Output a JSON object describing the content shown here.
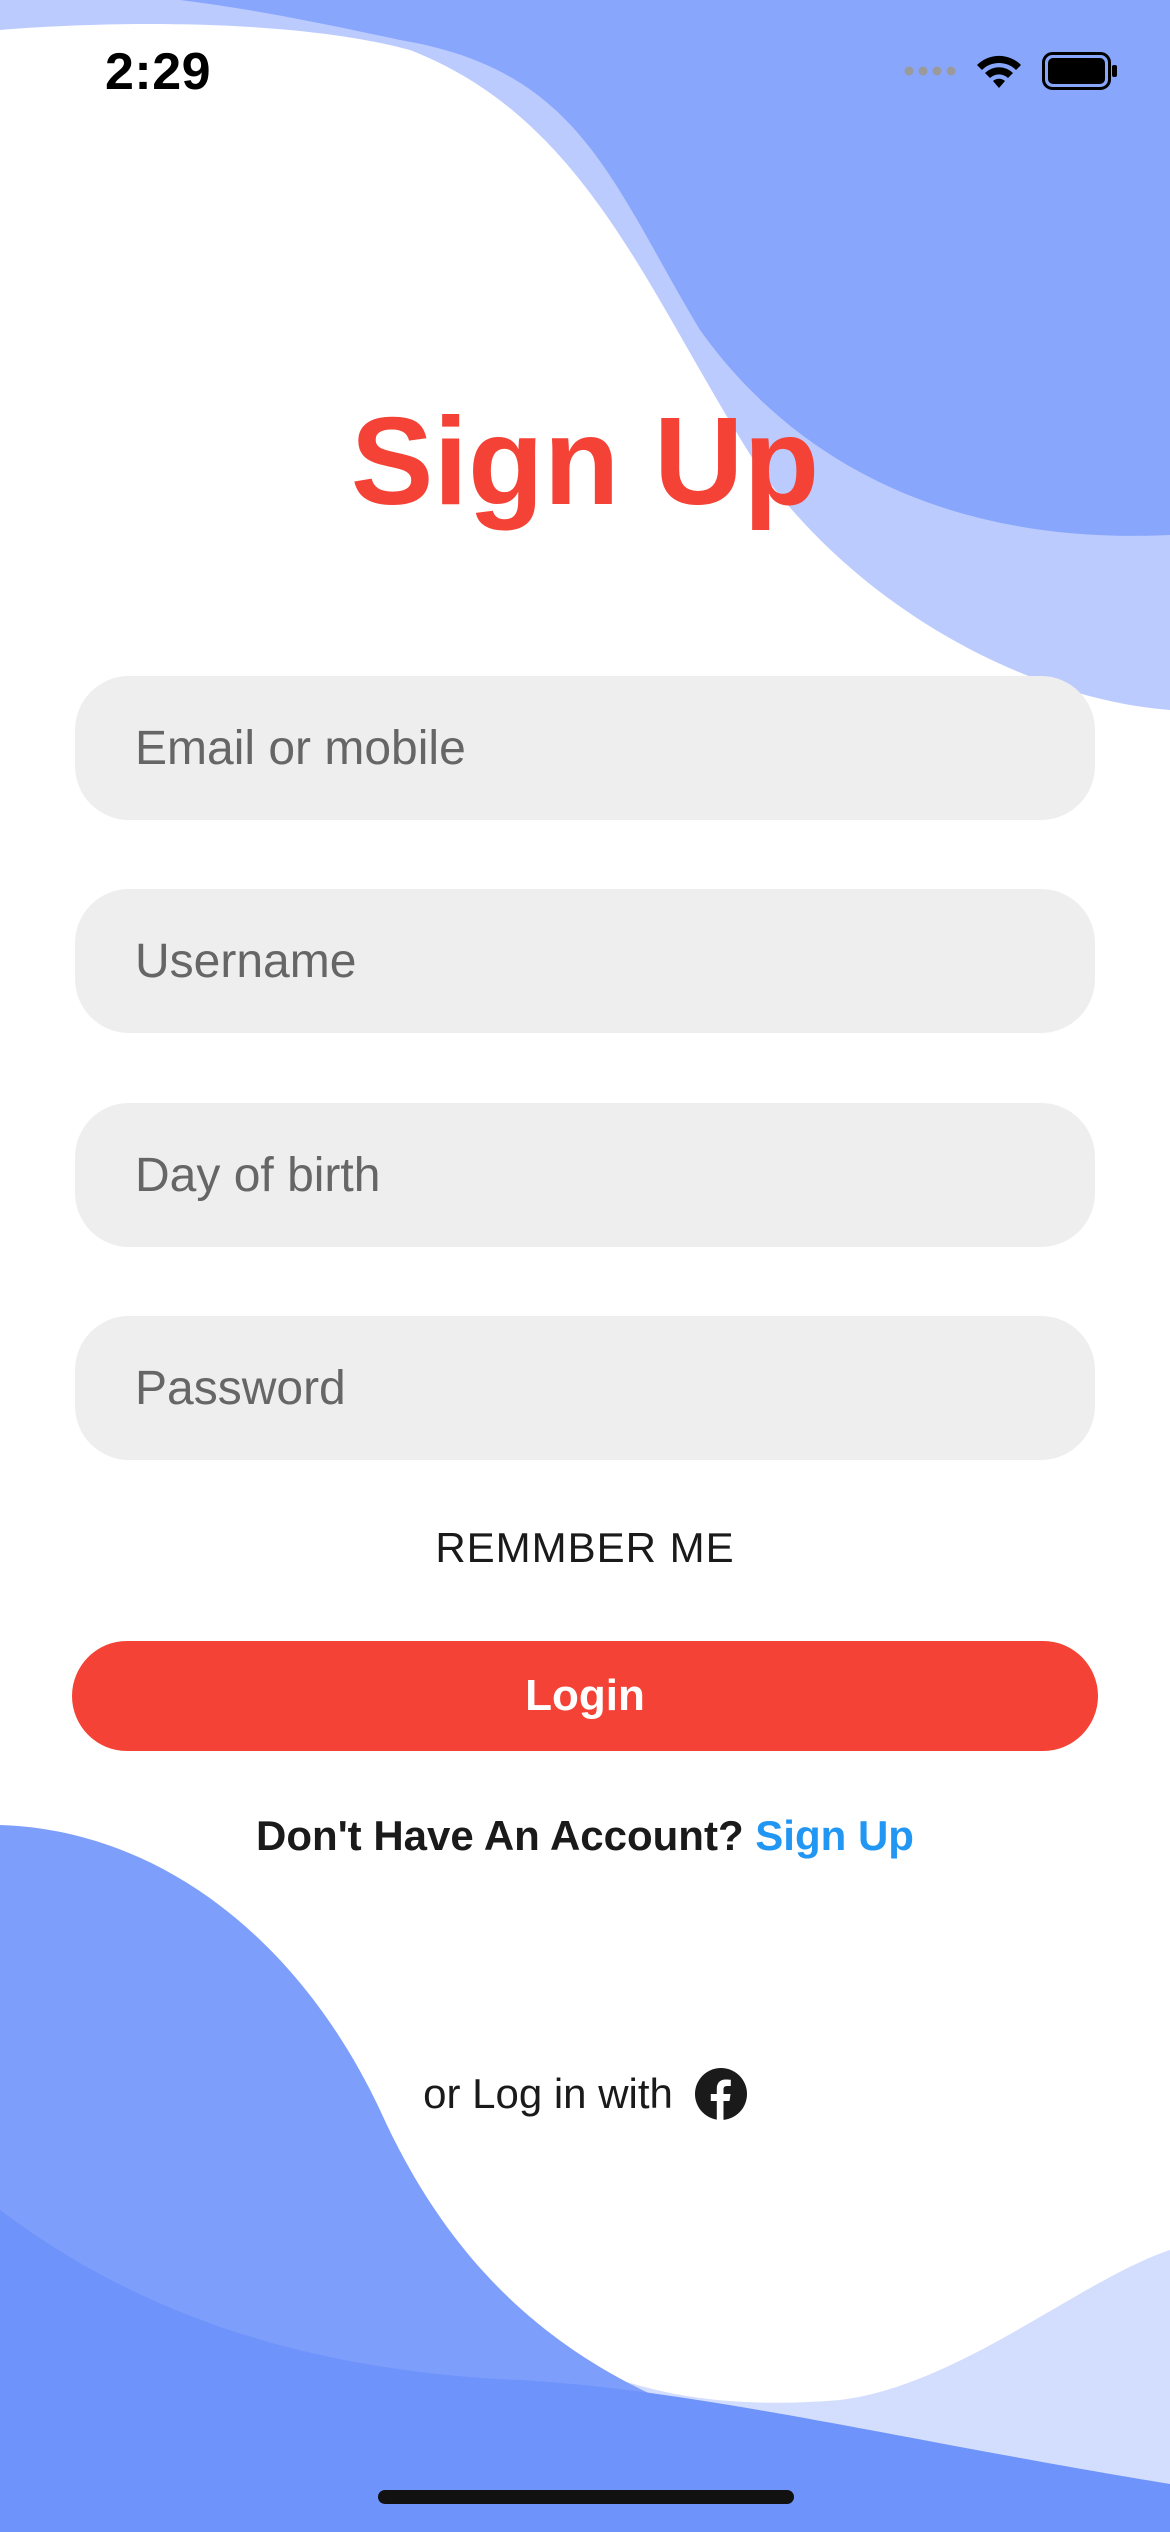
{
  "status_bar": {
    "time": "2:29",
    "icons": [
      "signal-dots-icon",
      "wifi-icon",
      "battery-icon"
    ]
  },
  "title": "Sign Up",
  "form": {
    "email_placeholder": "Email or mobile",
    "username_placeholder": "Username",
    "dob_placeholder": "Day of birth",
    "password_placeholder": "Password",
    "remember_label": "REMMBER ME",
    "login_label": "Login"
  },
  "account": {
    "prompt": "Don't Have An Account?",
    "link": "Sign Up"
  },
  "social": {
    "label": "or Log in with",
    "icon": "facebook-icon"
  },
  "colors": {
    "accent": "#F44336",
    "link": "#2196F3",
    "wave_dark": "#7B9CFA",
    "wave_light": "#B8C9FD",
    "field_bg": "#EEEEEE"
  }
}
